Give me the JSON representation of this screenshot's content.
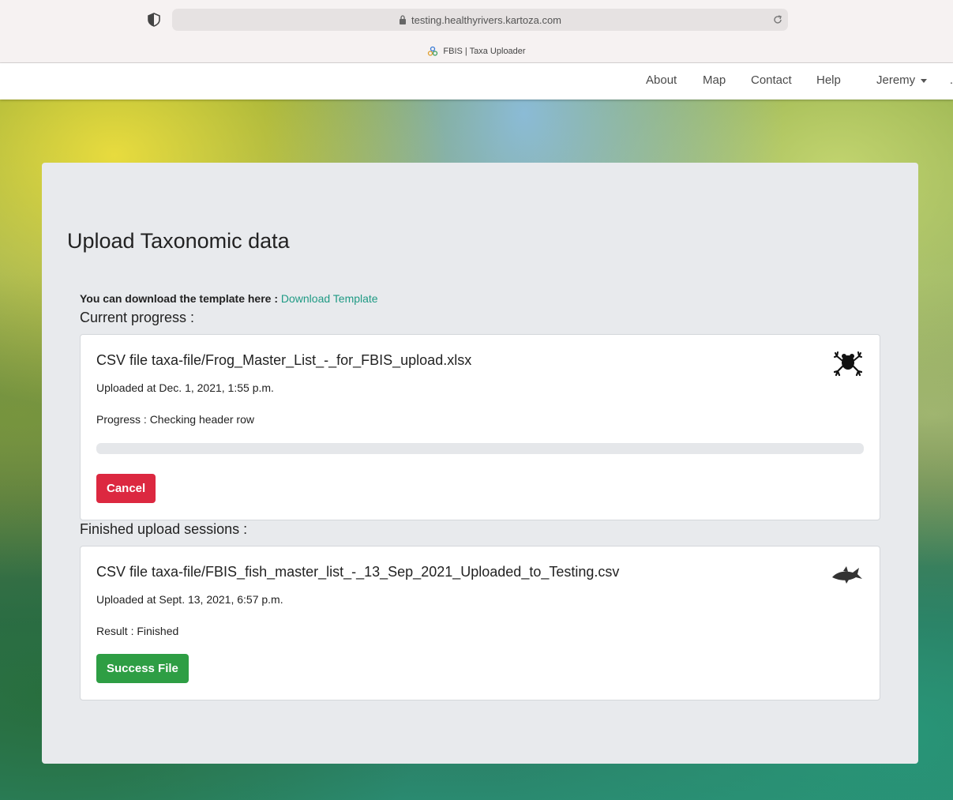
{
  "browser": {
    "url": "testing.healthyrivers.kartoza.com",
    "tab_title": "FBIS | Taxa Uploader"
  },
  "nav": {
    "items": [
      "About",
      "Map",
      "Contact",
      "Help"
    ],
    "user": "Jeremy"
  },
  "page": {
    "title": "Upload Taxonomic data",
    "download_prefix": "You can download the template here :",
    "download_link": "Download Template",
    "current_progress_label": "Current progress :",
    "finished_label": "Finished upload sessions :"
  },
  "current_upload": {
    "title": "CSV file taxa-file/Frog_Master_List_-_for_FBIS_upload.xlsx",
    "uploaded_at": "Uploaded at Dec. 1, 2021, 1:55 p.m.",
    "progress_text": "Progress : Checking header row",
    "progress_percent": 0,
    "cancel_label": "Cancel",
    "icon": "frog-icon"
  },
  "finished_upload": {
    "title": "CSV file taxa-file/FBIS_fish_master_list_-_13_Sep_2021_Uploaded_to_Testing.csv",
    "uploaded_at": "Uploaded at Sept. 13, 2021, 6:57 p.m.",
    "result_text": "Result : Finished",
    "success_label": "Success File",
    "icon": "fish-icon"
  },
  "colors": {
    "accent": "#1f9a84",
    "danger": "#dc2840",
    "success": "#2e9e44",
    "panel": "#e8eaed"
  }
}
